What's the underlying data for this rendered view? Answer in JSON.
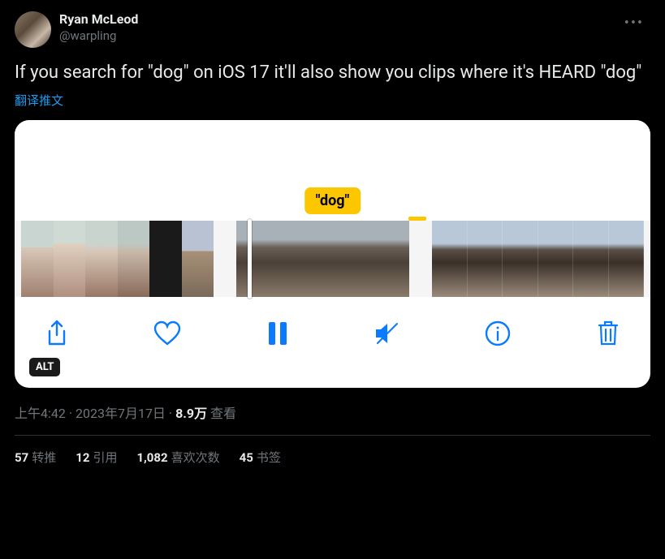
{
  "user": {
    "display_name": "Ryan McLeod",
    "handle": "@warpling"
  },
  "tweet_text": "If you search for \"dog\" on iOS 17 it'll also show you clips where it's HEARD \"dog\"",
  "translate_label": "翻译推文",
  "media": {
    "search_label": "\"dog\"",
    "alt_badge": "ALT",
    "controls": {
      "share": "share",
      "like": "like",
      "pause": "pause",
      "mute": "mute",
      "info": "info",
      "trash": "trash"
    }
  },
  "meta": {
    "time": "上午4:42",
    "date": "2023年7月17日",
    "views_count": "8.9万",
    "views_label": "查看"
  },
  "stats": {
    "retweets_count": "57",
    "retweets_label": "转推",
    "quotes_count": "12",
    "quotes_label": "引用",
    "likes_count": "1,082",
    "likes_label": "喜欢次数",
    "bookmarks_count": "45",
    "bookmarks_label": "书签"
  }
}
